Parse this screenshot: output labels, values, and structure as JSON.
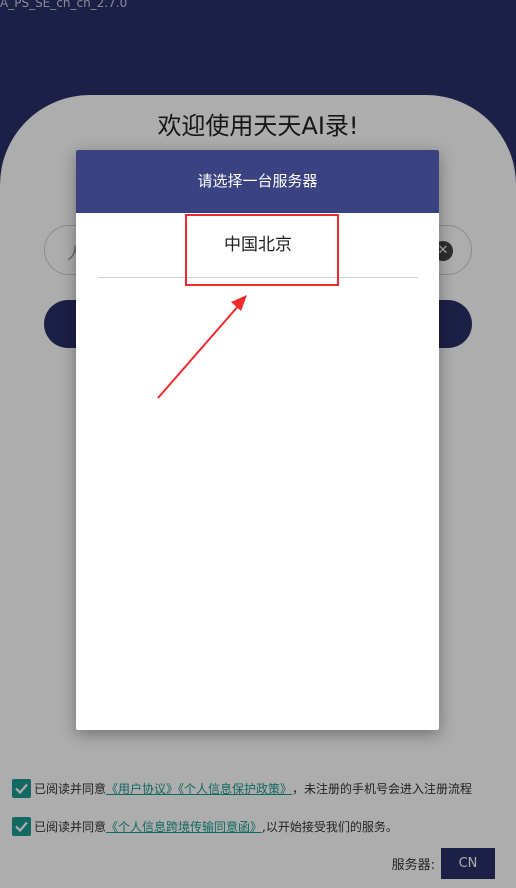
{
  "app": {
    "version": "A_PS_SE_ch_ch_2.7.0",
    "welcome": "欢迎使用天天AI录!"
  },
  "dialog": {
    "title": "请选择一台服务器",
    "servers": [
      "中国北京"
    ]
  },
  "agreements": {
    "line1_prefix": "已阅读并同意",
    "line1_link": "《用户协议》《个人信息保护政策》",
    "line1_suffix": "，未注册的手机号会进入注册流程",
    "line2_prefix": "已阅读并同意",
    "line2_link": "《个人信息跨境传输同意函》",
    "line2_suffix": ",以开始接受我们的服务。"
  },
  "server": {
    "label": "服务器:",
    "value": "CN"
  },
  "colors": {
    "primary": "#2c3068",
    "dialog_header": "#3a4281",
    "checkbox": "#1a9b8f",
    "annotation": "#ee2a2a"
  }
}
